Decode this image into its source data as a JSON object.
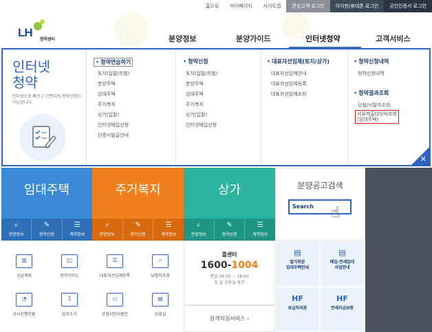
{
  "top_links": [
    "홈으로",
    "마이페이지",
    "사이트맵"
  ],
  "top_buttons": [
    "관심고객 로그인",
    "아이핀/휴대폰 로그인",
    "공인인증서 로그인"
  ],
  "logo": {
    "text": "LH",
    "sub": "청약센터"
  },
  "gnb": [
    "분양정보",
    "분양가이드",
    "인터넷청약",
    "고객서비스"
  ],
  "mega": {
    "title_line1": "인터넷",
    "title_line2": "청약",
    "desc": "인터넷으로 빠르고 간편하게 청약신청이 가능합니다.",
    "col1": {
      "head": "청약연습하기",
      "items": [
        "토지(입찰/추첨)",
        "분양주택",
        "임대주택",
        "주거복지",
        "상가(입찰)",
        "인터넷매입신청",
        "인증서발급안내"
      ]
    },
    "col2": {
      "head": "청약신청",
      "items": [
        "토지(입찰/추첨)",
        "분양주택",
        "임대주택",
        "주거복지",
        "상가(입찰)",
        "인터넷매입신청"
      ]
    },
    "col3": {
      "head": "대표자선임제(토지/상가)",
      "items": [
        "대표자선임제안내",
        "대표자선임제등록",
        "대표자선임제조회"
      ]
    },
    "col4": {
      "head1": "청약신청내역",
      "items1": [
        "청약신청내역"
      ],
      "head2": "청약결과조회",
      "items2": [
        "당첨/낙찰자조회"
      ],
      "highlight_line1": "서류제출대상자조회",
      "highlight_line2": "(임대주택)"
    }
  },
  "tiles": [
    {
      "name": "임대주택",
      "subs": [
        "분양정보",
        "청약신청",
        "계약정보"
      ]
    },
    {
      "name": "주거복지",
      "subs": [
        "분양정보",
        "청약신청",
        "계약정보"
      ]
    },
    {
      "name": "상가",
      "subs": [
        "분양정보",
        "청약신청",
        "계약정보"
      ]
    }
  ],
  "search": {
    "title": "분양공고검색",
    "button": "Search"
  },
  "quick": [
    "공급계획",
    "청약가이드",
    "대표자선임제등록",
    "당첨자조회",
    "공사진행현황",
    "입주소식",
    "공영서민위원안",
    "자료실"
  ],
  "call": {
    "label": "콜센터",
    "number_a": "1600-",
    "number_b": "1004",
    "hours1": "평일 09:00 ~ 18:00",
    "hours2": "토.일 공휴일 휴무"
  },
  "remote": "원격지원서비스  ›",
  "blue_tiles": [
    {
      "icon": "▤",
      "line1": "알기쉬운",
      "line2": "임대주택안내"
    },
    {
      "icon": "▤",
      "line1": "매입·전세임대",
      "line2": "사업안내"
    },
    {
      "icon": "HF",
      "line1": "보금자리론",
      "line2": ""
    },
    {
      "icon": "HF",
      "line1": "전세자금보증",
      "line2": ""
    }
  ],
  "colors": {
    "accent": "#2e63c5",
    "orange": "#f07f1e",
    "teal": "#2bb3a0",
    "blue": "#3a8ad8"
  }
}
